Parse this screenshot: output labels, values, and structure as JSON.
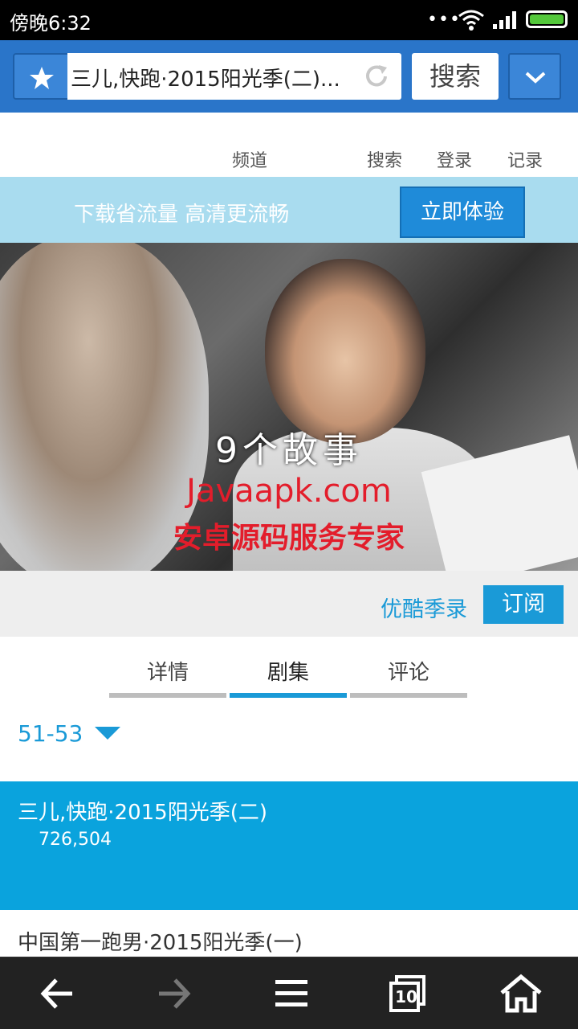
{
  "status_bar": {
    "time": "傍晚6:32",
    "dots": "•••",
    "icons": [
      "wifi-icon",
      "signal-icon",
      "battery-icon"
    ],
    "battery_color": "#54c83b"
  },
  "address_bar": {
    "url_text": "三儿,快跑·2015阳光季(二)...",
    "search_label": "搜索",
    "icons": [
      "star-icon",
      "refresh-icon",
      "chevron-down-icon"
    ]
  },
  "site_nav": {
    "items": [
      "频道",
      "搜索",
      "登录",
      "记录"
    ]
  },
  "promo": {
    "text": "下载省流量 高清更流畅",
    "button_label": "立即体验"
  },
  "video": {
    "subtitle": "9个故事",
    "watermark_line1": "Javaapk.com",
    "watermark_line2": "安卓源码服务专家"
  },
  "subscribe": {
    "channel": "优酷季录",
    "button_label": "订阅"
  },
  "tabs": [
    {
      "label": "详情",
      "active": false
    },
    {
      "label": "剧集",
      "active": true
    },
    {
      "label": "评论",
      "active": false
    }
  ],
  "episodes": {
    "range": "51-53",
    "items": [
      {
        "title": "三儿,快跑·2015阳光季(二)",
        "views": "726,504",
        "active": true
      },
      {
        "title": "中国第一跑男·2015阳光季(一)",
        "active": false
      }
    ]
  },
  "bottom_nav": {
    "tab_count": "10",
    "icons": [
      "back-arrow-icon",
      "forward-arrow-icon",
      "menu-icon",
      "tabs-icon",
      "home-icon"
    ]
  },
  "colors": {
    "accent": "#1a9ad7",
    "address_bar": "#2a75c9",
    "active_episode": "#0aa3dd"
  }
}
